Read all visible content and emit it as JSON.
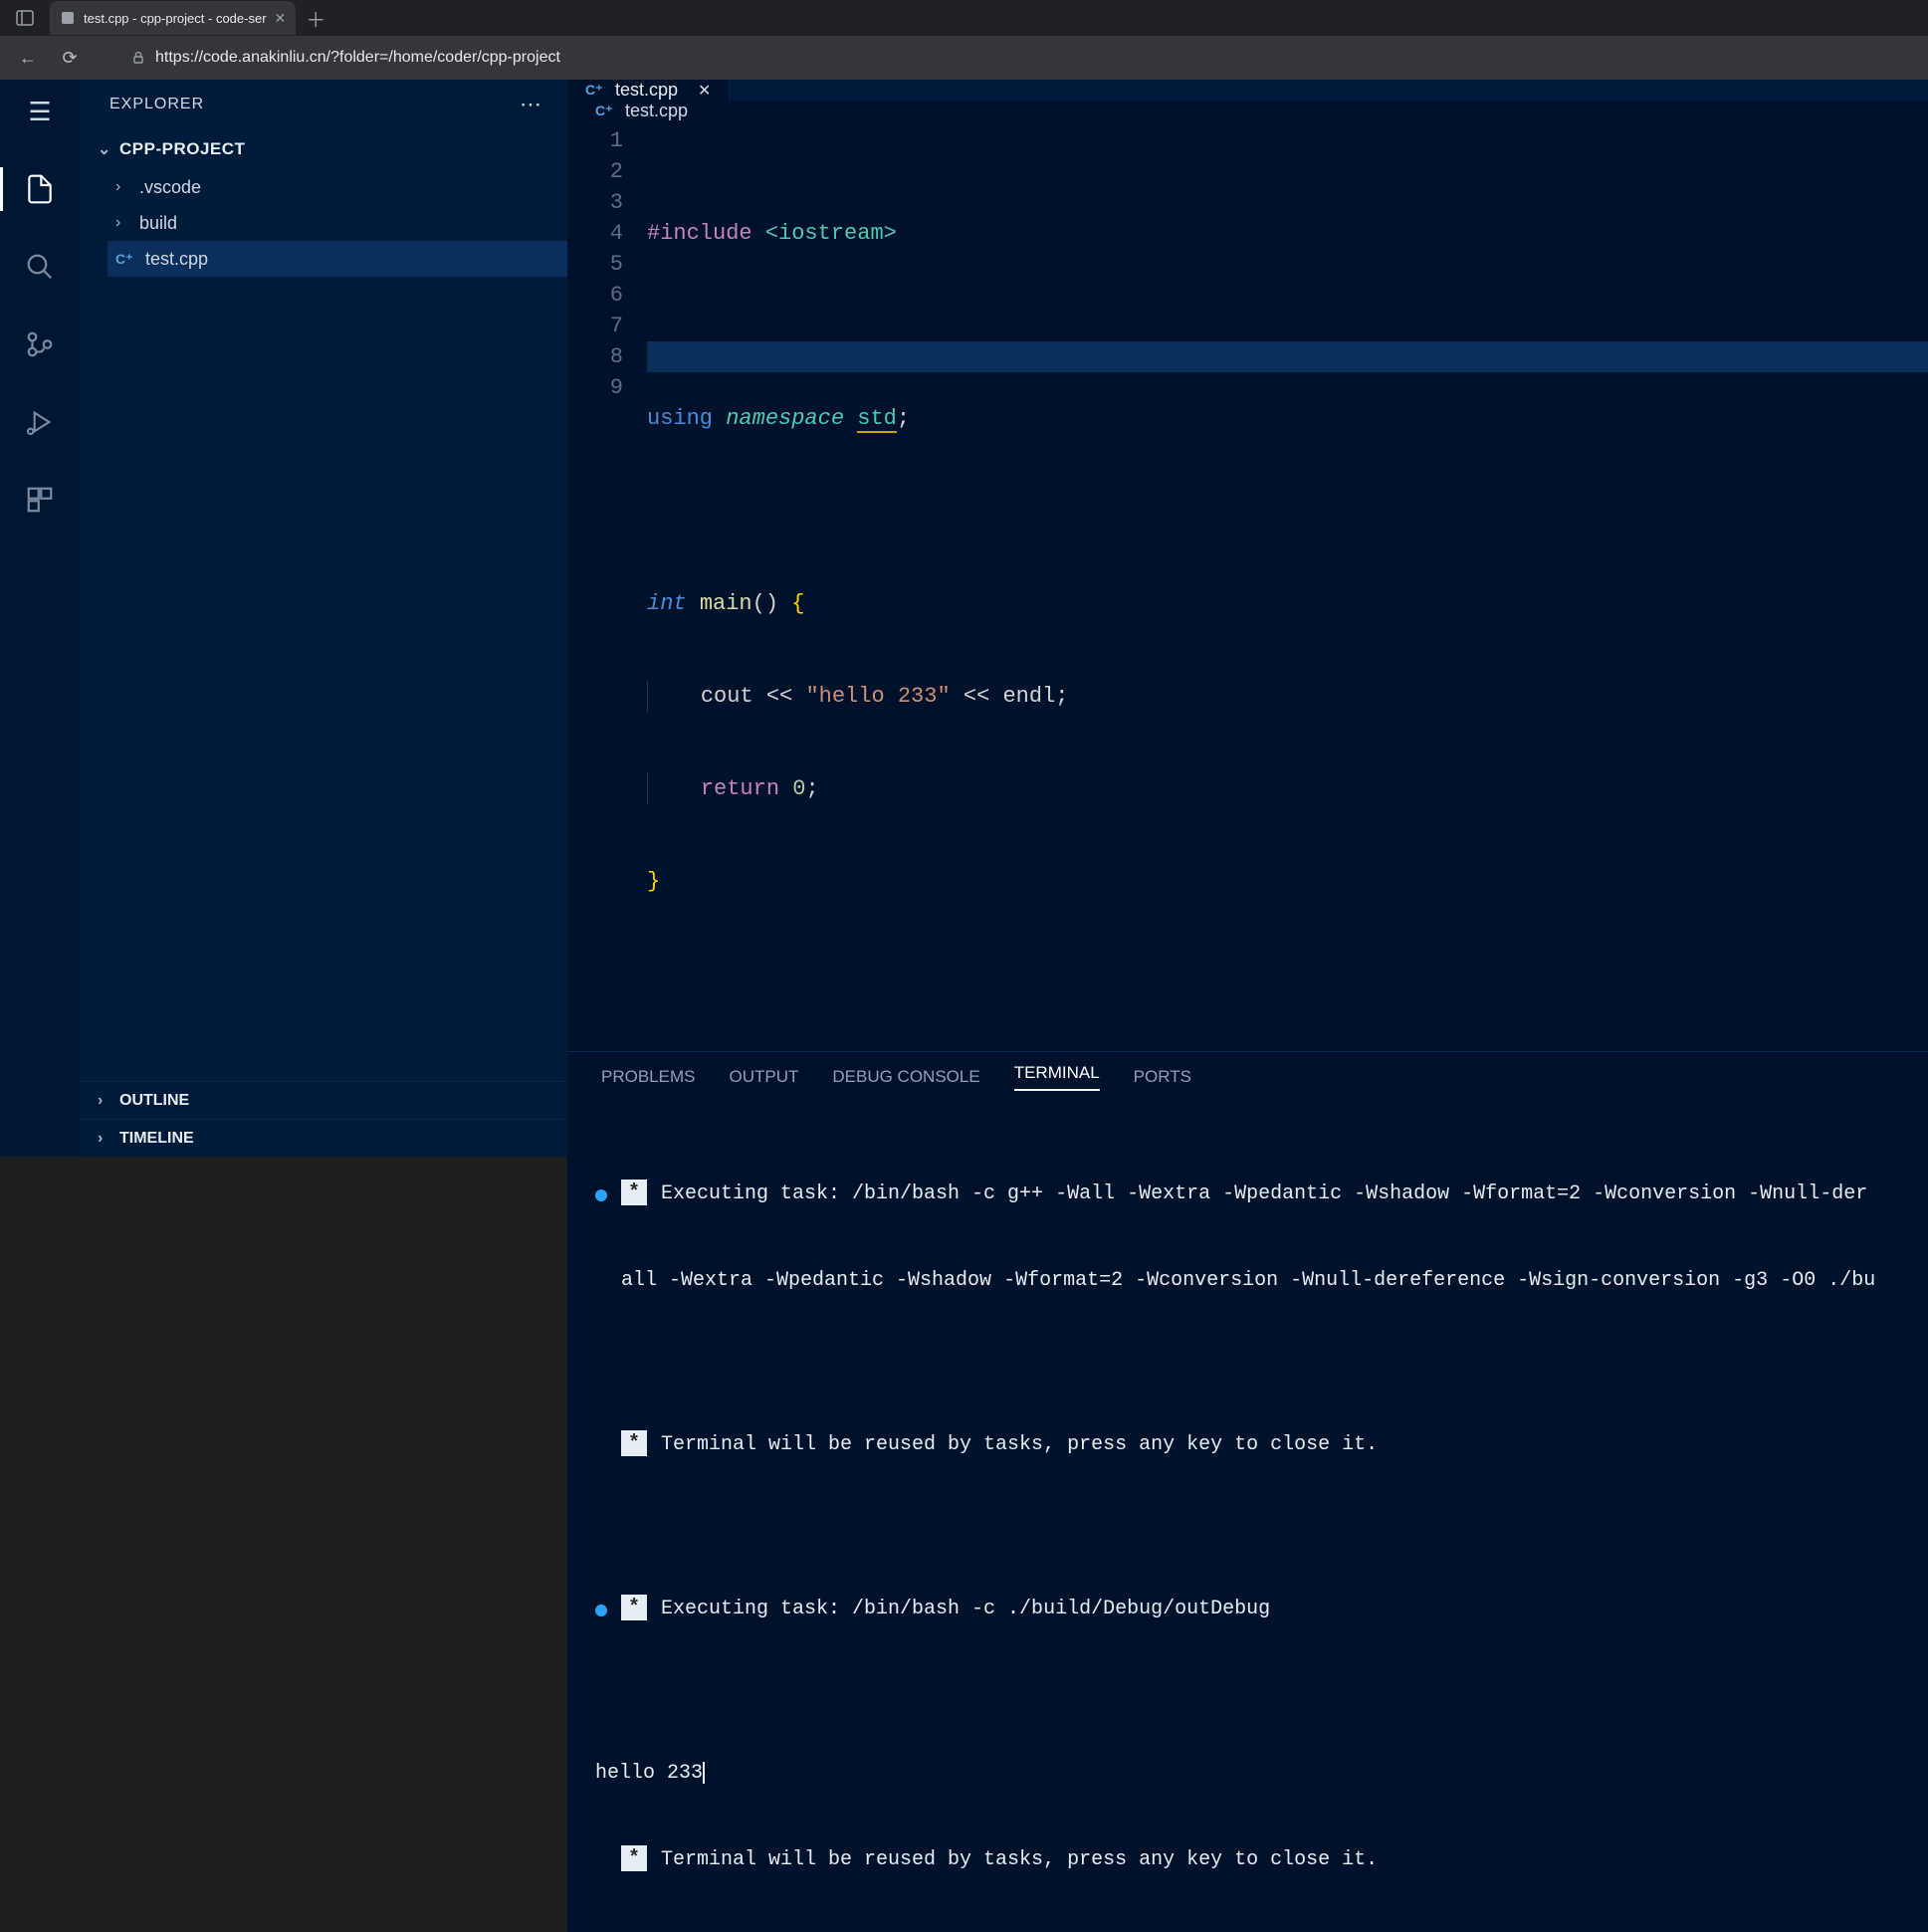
{
  "browser": {
    "tab_title": "test.cpp - cpp-project - code-ser",
    "url": "https://code.anakinliu.cn/?folder=/home/coder/cpp-project"
  },
  "sidebar": {
    "title": "EXPLORER",
    "folder": "CPP-PROJECT",
    "tree": [
      {
        "label": ".vscode",
        "type": "folder"
      },
      {
        "label": "build",
        "type": "folder"
      },
      {
        "label": "test.cpp",
        "type": "file",
        "selected": true
      }
    ],
    "sections": [
      "OUTLINE",
      "TIMELINE"
    ]
  },
  "activity_icons": [
    "menu",
    "files",
    "search",
    "source-control",
    "run-debug",
    "extensions"
  ],
  "editor": {
    "tab_label": "test.cpp",
    "breadcrumb": "test.cpp",
    "lines": [
      "#include <iostream>",
      "",
      "using namespace std;",
      "",
      "int main() {",
      "    cout << \"hello 233\" << endl;",
      "    return 0;",
      "}",
      ""
    ],
    "highlighted_line": 8
  },
  "panel": {
    "tabs": [
      "PROBLEMS",
      "OUTPUT",
      "DEBUG CONSOLE",
      "TERMINAL",
      "PORTS"
    ],
    "active_tab": "TERMINAL",
    "terminal": {
      "task1_line1": "Executing task: /bin/bash -c g++ -Wall -Wextra -Wpedantic -Wshadow -Wformat=2 -Wconversion -Wnull-der",
      "task1_line2": "all -Wextra -Wpedantic -Wshadow -Wformat=2 -Wconversion -Wnull-dereference -Wsign-conversion -g3 -O0 ./bu",
      "reuse1": "Terminal will be reused by tasks, press any key to close it.",
      "task2": "Executing task: /bin/bash -c ./build/Debug/outDebug",
      "output": "hello 233",
      "reuse2": "Terminal will be reused by tasks, press any key to close it."
    }
  }
}
